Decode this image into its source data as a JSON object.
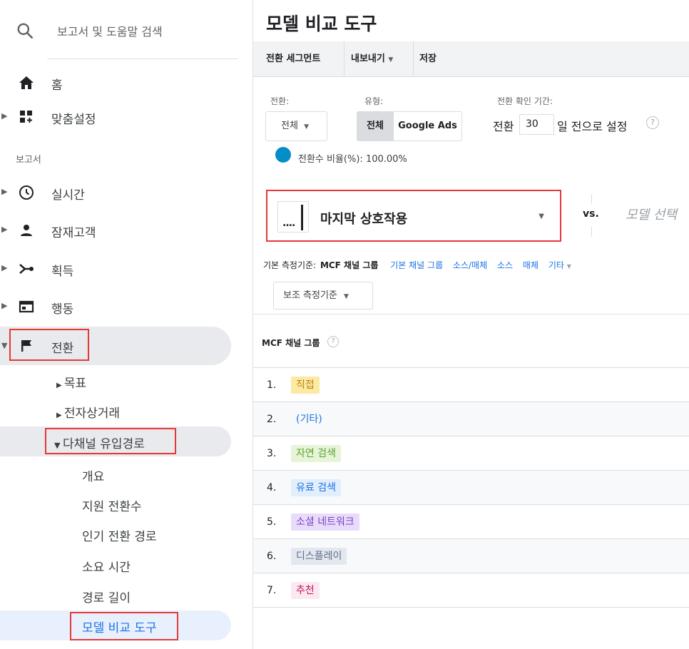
{
  "sidebar": {
    "search_placeholder": "보고서 및 도움말 검색",
    "home": "홈",
    "customize": "맞춤설정",
    "reports_label": "보고서",
    "realtime": "실시간",
    "audience": "잠재고객",
    "acquisition": "획득",
    "behavior": "행동",
    "conversions": "전환",
    "goals": "목표",
    "ecommerce": "전자상거래",
    "multichannel": "다채널 유입경로",
    "overview": "개요",
    "assisted": "지원 전환수",
    "top_paths": "인기 전환 경로",
    "time_lag": "소요 시간",
    "path_length": "경로 길이",
    "model_tool": "모델 비교 도구"
  },
  "main": {
    "title": "모델 비교 도구",
    "toolbar": {
      "segment": "전환 세그먼트",
      "export": "내보내기",
      "save": "저장"
    },
    "filters": {
      "conversion_label": "전환:",
      "conversion_value": "전체",
      "type_label": "유형:",
      "type_all": "전체",
      "type_ads": "Google Ads",
      "lookback_label": "전환 확인 기간:",
      "lookback_prefix": "전환",
      "lookback_days": "30",
      "lookback_suffix": "일 전으로 설정",
      "rate_text": "전환수 비율(%): 100.00%"
    },
    "model": {
      "selected": "마지막 상호작용",
      "vs": "vs.",
      "select_placeholder": "모델 선택"
    },
    "metrics": {
      "primary_label": "기본 측정기준:",
      "items": [
        "MCF 채널 그룹",
        "기본 채널 그룹",
        "소스/매체",
        "소스",
        "매체",
        "기타"
      ],
      "secondary": "보조 측정기준"
    },
    "table": {
      "header": "MCF 채널 그룹",
      "rows": [
        {
          "num": "1.",
          "label": "직접"
        },
        {
          "num": "2.",
          "label": "(기타)"
        },
        {
          "num": "3.",
          "label": "자연 검색"
        },
        {
          "num": "4.",
          "label": "유료 검색"
        },
        {
          "num": "5.",
          "label": "소셜 네트워크"
        },
        {
          "num": "6.",
          "label": "디스플레이"
        },
        {
          "num": "7.",
          "label": "추천"
        }
      ]
    }
  },
  "colors": {
    "direct": "#fbe9a4",
    "organic": "#e6f4d7",
    "paid": "#e3eefc",
    "social": "#e9dcfb",
    "display": "#e3e8f0",
    "referral": "#fce8f1",
    "link": "#1a73e8",
    "highlight": "#e53935"
  }
}
